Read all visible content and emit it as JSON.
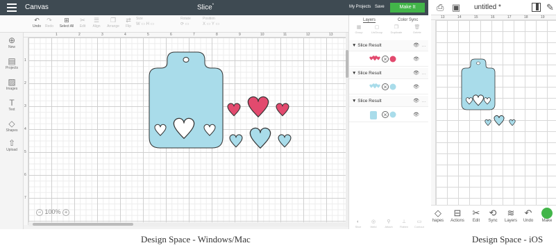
{
  "desktop": {
    "title": "Canvas",
    "project": "Slice",
    "project_mark": "*",
    "my_projects": "My Projects",
    "save": "Save",
    "make_it": "Make It",
    "toolbar": [
      {
        "icon": "undo-icon",
        "label": "Undo",
        "dim": false
      },
      {
        "icon": "redo-icon",
        "label": "Redo",
        "dim": true
      },
      {
        "icon": "select-all-icon",
        "label": "Select All",
        "dim": false
      },
      {
        "icon": "edit-icon",
        "label": "Edit",
        "dim": true
      },
      {
        "icon": "align-icon",
        "label": "Align",
        "dim": true
      },
      {
        "icon": "arrange-icon",
        "label": "Arrange",
        "dim": true
      },
      {
        "icon": "flip-icon",
        "label": "Flip",
        "dim": true
      },
      {
        "icon": "size-icon",
        "label": "Size",
        "dim": true
      },
      {
        "icon": "rotate-icon",
        "label": "Rotate",
        "dim": true
      },
      {
        "icon": "position-icon",
        "label": "Position",
        "dim": true
      }
    ],
    "sidebar": [
      {
        "icon": "new-icon",
        "glyph": "⊕",
        "label": "New"
      },
      {
        "icon": "projects-icon",
        "glyph": "▤",
        "label": "Projects"
      },
      {
        "icon": "images-icon",
        "glyph": "▨",
        "label": "Images"
      },
      {
        "icon": "text-icon",
        "glyph": "T",
        "label": "Text"
      },
      {
        "icon": "shapes-icon",
        "glyph": "◇",
        "label": "Shapes"
      },
      {
        "icon": "upload-icon",
        "glyph": "⇧",
        "label": "Upload"
      }
    ],
    "ruler_top": [
      "1",
      "2",
      "3",
      "4",
      "5",
      "6",
      "7",
      "8",
      "9",
      "10",
      "11",
      "12",
      "13"
    ],
    "ruler_left": [
      "1",
      "2",
      "3",
      "4",
      "5",
      "6",
      "7"
    ],
    "zoom_minus": "−",
    "zoom": "100%",
    "zoom_plus": "+",
    "layers_panel": {
      "tabs": [
        "Layers",
        "Color Sync"
      ],
      "tools": [
        "Group",
        "UnGroup",
        "Duplicate",
        "Delete"
      ],
      "groups": [
        {
          "name": "Slice Result",
          "color": "#e24a6e"
        },
        {
          "name": "Slice Result",
          "color": "#a9dcea"
        },
        {
          "name": "Slice Result",
          "color": "#a9dcea"
        }
      ],
      "bottom_tools": [
        "Slice",
        "Weld",
        "Attach",
        "Flatten",
        "Contour"
      ]
    },
    "colors": {
      "tag": "#a9dcea",
      "heart_pink": "#e24a6e",
      "heart_blue": "#a9dcea",
      "make_it": "#42b549"
    }
  },
  "ios": {
    "title": "untitled *",
    "ruler_top": [
      "13",
      "14",
      "15",
      "16",
      "17",
      "18",
      "19"
    ],
    "bottom": [
      {
        "icon": "shapes-icon",
        "label": "hapes"
      },
      {
        "icon": "actions-icon",
        "label": "Actions"
      },
      {
        "icon": "edit-icon",
        "label": "Edit"
      },
      {
        "icon": "sync-icon",
        "label": "Sync"
      },
      {
        "icon": "layers-icon",
        "label": "Layers"
      },
      {
        "icon": "undo-icon",
        "label": "Undo"
      },
      {
        "icon": "make-icon",
        "label": "Make"
      }
    ]
  },
  "captions": {
    "desktop": "Design Space - Windows/Mac",
    "ios": "Design Space - iOS"
  }
}
